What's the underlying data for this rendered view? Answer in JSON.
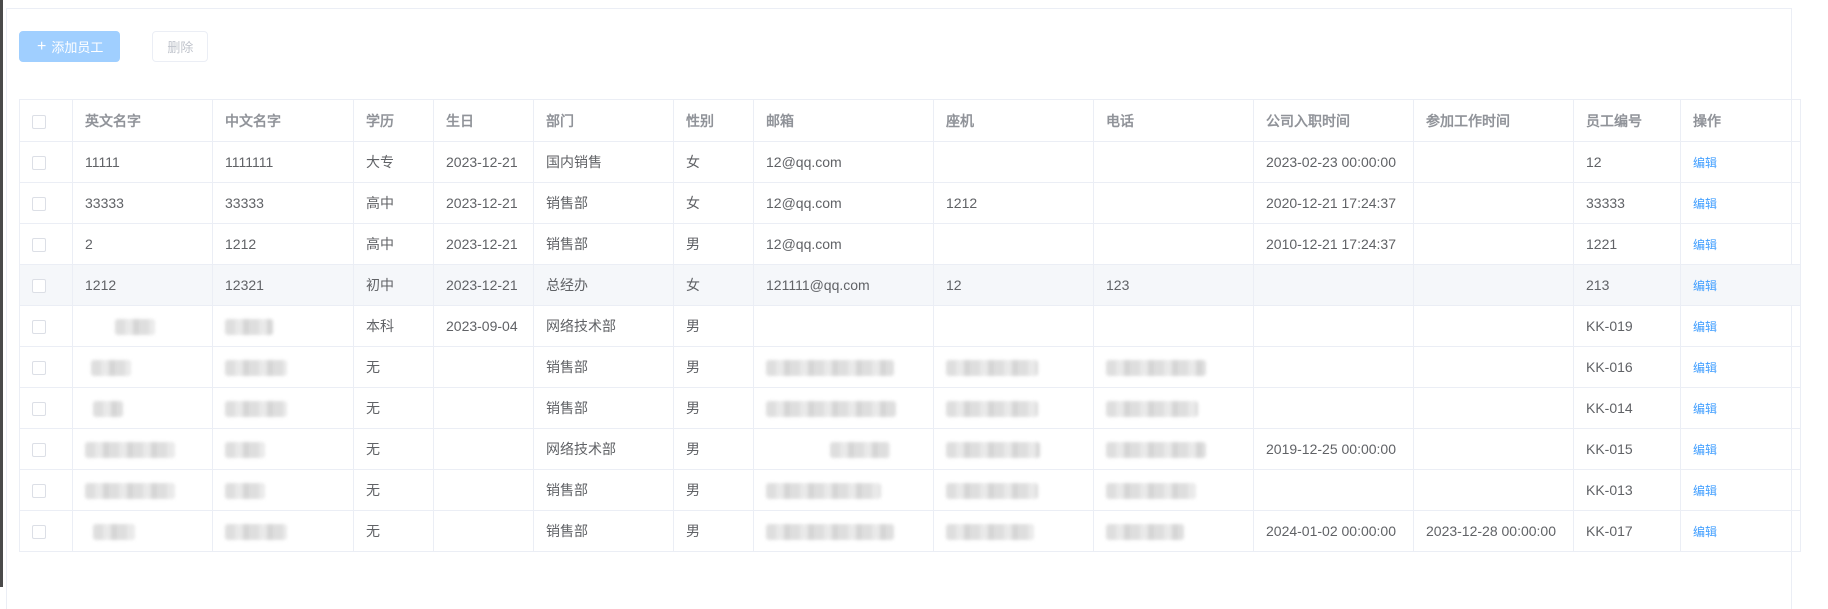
{
  "toolbar": {
    "add_label": "添加员工",
    "delete_label": "删除"
  },
  "table": {
    "columns": [
      "英文名字",
      "中文名字",
      "学历",
      "生日",
      "部门",
      "性别",
      "邮箱",
      "座机",
      "电话",
      "公司入职时间",
      "参加工作时间",
      "员工编号",
      "操作"
    ],
    "edit_label": "编辑",
    "rows": [
      {
        "en_name": "11111",
        "cn_name": "1111111",
        "education": "大专",
        "birthday": "2023-12-21",
        "department": "国内销售",
        "gender": "女",
        "email": "12@qq.com",
        "landline": "",
        "phone": "",
        "hire_date": "2023-02-23 00:00:00",
        "work_start": "",
        "emp_no": "12"
      },
      {
        "en_name": "33333",
        "cn_name": "33333",
        "education": "高中",
        "birthday": "2023-12-21",
        "department": "销售部",
        "gender": "女",
        "email": "12@qq.com",
        "landline": "1212",
        "phone": "",
        "hire_date": "2020-12-21 17:24:37",
        "work_start": "",
        "emp_no": "33333"
      },
      {
        "en_name": "2",
        "cn_name": "1212",
        "education": "高中",
        "birthday": "2023-12-21",
        "department": "销售部",
        "gender": "男",
        "email": "12@qq.com",
        "landline": "",
        "phone": "",
        "hire_date": "2010-12-21 17:24:37",
        "work_start": "",
        "emp_no": "1221"
      },
      {
        "en_name": "1212",
        "cn_name": "12321",
        "education": "初中",
        "birthday": "2023-12-21",
        "department": "总经办",
        "gender": "女",
        "email": "121111@qq.com",
        "landline": "12",
        "phone": "123",
        "hire_date": "",
        "work_start": "",
        "emp_no": "213"
      },
      {
        "en_name": "",
        "cn_name": "",
        "education": "本科",
        "birthday": "2023-09-04",
        "department": "网络技术部",
        "gender": "男",
        "email": "",
        "landline": "",
        "phone": "",
        "hire_date": "",
        "work_start": "",
        "emp_no": "KK-019"
      },
      {
        "en_name": "",
        "cn_name": "",
        "education": "无",
        "birthday": "",
        "department": "销售部",
        "gender": "男",
        "email": "",
        "landline": "",
        "phone": "",
        "hire_date": "",
        "work_start": "",
        "emp_no": "KK-016"
      },
      {
        "en_name": "",
        "cn_name": "",
        "education": "无",
        "birthday": "",
        "department": "销售部",
        "gender": "男",
        "email": "",
        "landline": "",
        "phone": "",
        "hire_date": "",
        "work_start": "",
        "emp_no": "KK-014"
      },
      {
        "en_name": "",
        "cn_name": "",
        "education": "无",
        "birthday": "",
        "department": "网络技术部",
        "gender": "男",
        "email": "",
        "landline": "",
        "phone": "",
        "hire_date": "2019-12-25 00:00:00",
        "work_start": "",
        "emp_no": "KK-015"
      },
      {
        "en_name": "",
        "cn_name": "",
        "education": "无",
        "birthday": "",
        "department": "销售部",
        "gender": "男",
        "email": "",
        "landline": "",
        "phone": "",
        "hire_date": "",
        "work_start": "",
        "emp_no": "KK-013"
      },
      {
        "en_name": "",
        "cn_name": "",
        "education": "无",
        "birthday": "",
        "department": "销售部",
        "gender": "男",
        "email": "",
        "landline": "",
        "phone": "",
        "hire_date": "2024-01-02 00:00:00",
        "work_start": "2023-12-28 00:00:00",
        "emp_no": "KK-017"
      }
    ]
  },
  "colors": {
    "primary_light": "#a0cfff",
    "link": "#409eff",
    "border": "#ebeef5",
    "header_text": "#909399",
    "body_text": "#606266",
    "row_hover": "#f5f7fa"
  }
}
